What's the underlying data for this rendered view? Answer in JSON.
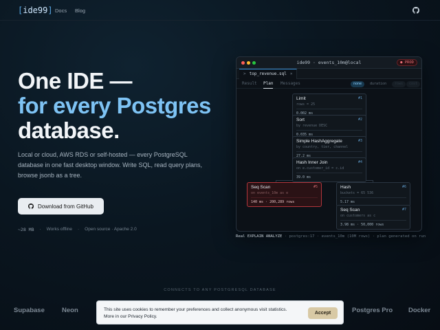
{
  "nav": {
    "logo": {
      "bracket_open": "[",
      "name": "ide99",
      "bracket_close": "]"
    },
    "links": [
      "Docs",
      "Blog"
    ],
    "github_icon": "github-icon"
  },
  "hero": {
    "line1": "One IDE —",
    "line2": "for every Postgres",
    "line3": "database.",
    "lede": "Local or cloud, AWS RDS or self-hosted — every PostgreSQL database in one fast desktop window. Write SQL, read query plans, browse jsonb as a tree.",
    "cta_label": "Download from GitHub",
    "stats": [
      "~28 MB",
      "·",
      "Works offline",
      "·",
      "Open source · Apache 2.0"
    ]
  },
  "window": {
    "title": "ide99 · events_10m@local",
    "env_badge": "● PROD",
    "file_tab": "top_revenue.sql",
    "file_tab_close": "×",
    "file_tab_icon": ">",
    "subtabs": [
      "Result",
      "Plan",
      "Messages"
    ],
    "active_subtab": "Plan",
    "view_pills": [
      "none",
      "duration",
      "rows",
      "cost"
    ],
    "plan_nodes": [
      {
        "name": "Limit",
        "idx": "#1",
        "detail": "rows = 25",
        "metric": "0.002 ms"
      },
      {
        "name": "Sort",
        "idx": "#2",
        "detail": "by revenue DESC",
        "metric": "0.035 ms"
      },
      {
        "name": "Simple HashAggregate",
        "idx": "#3",
        "detail": "by country, tier, channel",
        "metric": "27.2 ms"
      },
      {
        "name": "Hash Inner Join",
        "idx": "#4",
        "detail": "on e.customer_id = c.id",
        "metric": "39.0 ms"
      },
      {
        "name": "Seq Scan",
        "idx": "#5",
        "detail": "on events_10m as e",
        "metric": "140 ms · 200,289 rows"
      },
      {
        "name": "Hash",
        "idx": "#6",
        "detail": "buckets = 65 536",
        "metric": "5.17 ms"
      },
      {
        "name": "Seq Scan",
        "idx": "#7",
        "detail": "on customers as c",
        "metric": "3.98 ms · 50,000 rows"
      }
    ]
  },
  "caption": {
    "lead": "Real EXPLAIN ANALYZE",
    "rest": " · postgres:17 · events_10m (10M rows) · plan generated on run"
  },
  "connects_label": "CONNECTS TO ANY POSTGRESQL DATABASE",
  "brands": [
    "Supabase",
    "Neon",
    "Postgres Pro",
    "Docker"
  ],
  "cookie": {
    "text_line1": "This site uses cookies to remember your preferences and collect anonymous visit statistics.",
    "text_line2": "More in our Privacy Policy.",
    "accept_label": "Accept"
  },
  "colors": {
    "accent": "#7ec3f4",
    "hot_node": "#b3363c",
    "prod_badge": "#f07178",
    "accept_bg": "#d8c9a5"
  }
}
